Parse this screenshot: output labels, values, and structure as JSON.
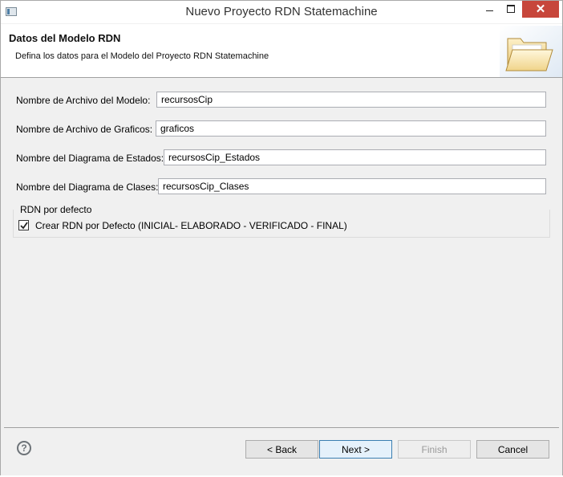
{
  "window": {
    "title": "Nuevo Proyecto RDN Statemachine",
    "close_glyph": "✕"
  },
  "banner": {
    "title": "Datos del Modelo RDN",
    "description": "Defina los datos para el Modelo del Proyecto RDN Statemachine",
    "icon": "open-folder-icon"
  },
  "form": {
    "model_file": {
      "label": "Nombre de Archivo del Modelo:",
      "value": "recursosCip"
    },
    "graphics_file": {
      "label": "Nombre de Archivo de Graficos:",
      "value": "graficos"
    },
    "states_diagram": {
      "label": "Nombre del Diagrama de Estados:",
      "value": "recursosCip_Estados"
    },
    "classes_diagram": {
      "label": "Nombre del Diagrama de Clases:",
      "value": "recursosCip_Clases"
    }
  },
  "defaults_group": {
    "title": "RDN por defecto",
    "checkbox_label": "Crear RDN por Defecto (INICIAL- ELABORADO - VERIFICADO - FINAL)",
    "checked": true
  },
  "footer": {
    "help_glyph": "?",
    "back_label": "< Back",
    "next_label": "Next >",
    "finish_label": "Finish",
    "cancel_label": "Cancel"
  },
  "colors": {
    "close_button": "#c7463b",
    "default_button_border": "#3c7fb1",
    "dialog_background": "#f0f0f0"
  }
}
